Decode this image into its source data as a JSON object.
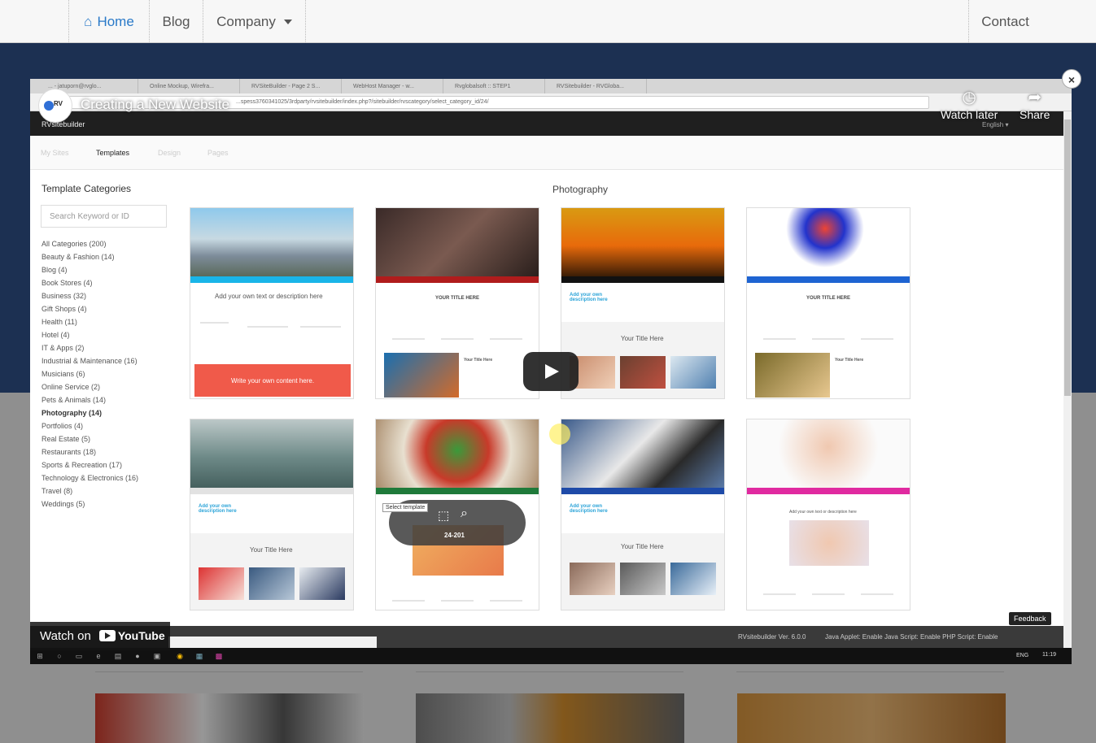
{
  "site_nav": {
    "home": "Home",
    "blog": "Blog",
    "company": "Company",
    "contact": "Contact"
  },
  "video": {
    "title": "Creating a New Website",
    "watch_later": "Watch later",
    "share": "Share",
    "watch_on": "Watch on",
    "youtube": "YouTube",
    "close_icon": "×"
  },
  "browser": {
    "tabs": [
      "... - jatuporn@rvglo...",
      "Online Mockup, Wirefra...",
      "RVSiteBuilder - Page 2 S...",
      "WebHost Manager - w...",
      "Rvglobalsoft :: STEP1",
      "RVSitebuilder - RVGloba..."
    ],
    "url": "...spess3760341025/3rdparty/rvsitebuilder/index.php?/sitebuilder/rvscategory/select_category_id/24/"
  },
  "app": {
    "brand": "RVsitebuilder",
    "lang": "English ▾",
    "tabs": [
      "My Sites",
      "Templates",
      "Design",
      "Pages"
    ],
    "active_tab": "Templates",
    "categories_title": "Template Categories",
    "search_placeholder": "Search Keyword or ID",
    "categories": [
      "All Categories (200)",
      "Beauty & Fashion (14)",
      "Blog (4)",
      "Book Stores (4)",
      "Business (32)",
      "Gift Shops (4)",
      "Health (11)",
      "Hotel (4)",
      "IT & Apps (2)",
      "Industrial & Maintenance (16)",
      "Musicians (6)",
      "Online Service (2)",
      "Pets & Animals (14)",
      "Photography (14)",
      "Portfolios (4)",
      "Real Estate (5)",
      "Restaurants (18)",
      "Sports & Recreation (17)",
      "Technology & Electronics (16)",
      "Travel (8)",
      "Weddings (5)"
    ],
    "selected_category": "Photography (14)",
    "section_title": "Photography",
    "card_texts": {
      "add_text": "Add your own text or description here",
      "write_content": "Write your own content here.",
      "your_title": "YOUR TITLE HERE",
      "your_title_here": "Your Title Here",
      "add_desc": "Add your own description here"
    },
    "hover": {
      "tooltip": "Select template",
      "id": "24-201"
    },
    "feedback": "Feedback",
    "version": "RVsitebuilder Ver. 6.0.0",
    "applet": "Java Applet: Enable Java Script: Enable PHP Script: Enable"
  },
  "taskbar": {
    "lang": "ENG",
    "time": "11:19"
  }
}
